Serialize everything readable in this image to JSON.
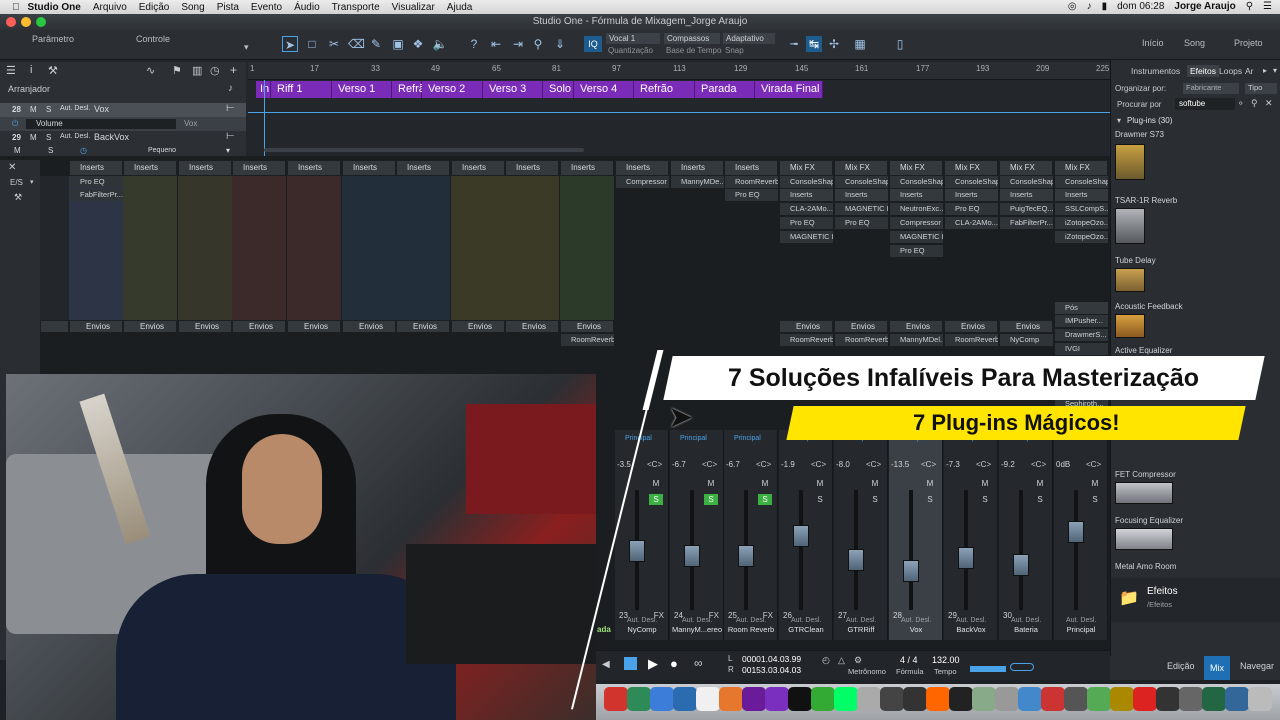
{
  "menubar": {
    "app": "Studio One",
    "items": [
      "Arquivo",
      "Edição",
      "Song",
      "Pista",
      "Evento",
      "Áudio",
      "Transporte",
      "Visualizar",
      "Ajuda"
    ],
    "clock": "dom 06:28",
    "user": "Jorge Araujo"
  },
  "window": {
    "title": "Studio One - Fórmula de Mixagem_Jorge Araujo"
  },
  "toolbar": {
    "parametro": "Parâmetro",
    "controle": "Controle",
    "quantizacao_value": "Vocal 1",
    "quantizacao_label": "Quantização",
    "base_value": "Compassos",
    "base_label": "Base de Tempo",
    "snap_value": "Adaptativo",
    "snap_label": "Snap",
    "iq": "IQ",
    "nav": [
      "Início",
      "Song",
      "Projeto"
    ]
  },
  "arranger": {
    "label": "Arranjador",
    "ticks": [
      "1",
      "17",
      "33",
      "49",
      "65",
      "81",
      "97",
      "113",
      "129",
      "145",
      "161",
      "177",
      "193",
      "209",
      "225"
    ],
    "sections": [
      "In",
      "Riff 1",
      "Verso 1",
      "Refrã",
      "Verso 2",
      "Verso 3",
      "Solo",
      "Verso 4",
      "Refrão",
      "Parada",
      "Virada Final"
    ]
  },
  "tracks": [
    {
      "num": "28",
      "m": "M",
      "s": "S",
      "auto": "Aut. Desl.",
      "name": "Vox"
    },
    {
      "param": "Volume",
      "target": "Vox"
    },
    {
      "num": "29",
      "m": "M",
      "s": "S",
      "auto": "Aut. Desl.",
      "name": "BackVox"
    },
    {
      "m": "M",
      "s": "S",
      "size": "Pequeno"
    }
  ],
  "mixer": {
    "es": "E/S",
    "inserts_label": "Inserts",
    "mixfx_label": "Mix FX",
    "envios_label": "Envios",
    "pos_label": "Pós",
    "inserts_col1": [
      "Pro EQ",
      "FabFilterPr..."
    ],
    "inserts_compressor": [
      "Compressor"
    ],
    "inserts_manny": [
      "MannyMDe..."
    ],
    "inserts_room": [
      "RoomReverb",
      "Pro EQ"
    ],
    "mixfx_cols": [
      {
        "a": "ConsoleShaper",
        "b": "Inserts",
        "c": "CLA-2AMo...",
        "d": "Pro EQ",
        "e": "MAGNETIC II"
      },
      {
        "a": "ConsoleShaper",
        "b": "Inserts",
        "c": "MAGNETIC II",
        "d": "Pro EQ",
        "e": ""
      },
      {
        "a": "ConsoleShaper",
        "b": "Inserts",
        "c": "NeutronExc...",
        "d": "Compressor",
        "e": "MAGNETIC II",
        "f": "Pro EQ"
      },
      {
        "a": "ConsoleShaper",
        "b": "Inserts",
        "c": "Pro EQ",
        "d": "CLA-2AMo...",
        "e": ""
      },
      {
        "a": "ConsoleShaper",
        "b": "Inserts",
        "c": "PuigTecEQ...",
        "d": "FabFilterPr...",
        "e": ""
      },
      {
        "a": "ConsoleShaper",
        "b": "Inserts",
        "c": "SSLCompS...",
        "d": "iZotopeOzo...",
        "e": "iZotopeOzo..."
      }
    ],
    "pos_plugins": [
      "IMPusher...",
      "DrawmerS...",
      "IVGI",
      "Sephiroth..."
    ],
    "sends": [
      "RoomReverb",
      "RoomReverb",
      "RoomReverb",
      "MannyMDel...",
      "RoomReverb",
      "NyComp"
    ],
    "channels": [
      {
        "num": "23",
        "val": "-3.5",
        "name": "NyComp",
        "auto": "Aut. Desl.",
        "bus": "Principal",
        "fader": 0.55
      },
      {
        "num": "24",
        "val": "-6.7",
        "name": "MannyM...ereo",
        "auto": "Aut. Desl.",
        "bus": "Principal",
        "fader": 0.5
      },
      {
        "num": "25",
        "val": "-6.7",
        "name": "Room Reverb",
        "auto": "Aut. Desl.",
        "bus": "Principal",
        "fader": 0.5
      },
      {
        "num": "26",
        "val": "-1.9",
        "name": "GTRClean",
        "auto": "Aut. Desl.",
        "bus": "Principal",
        "fader": 0.68
      },
      {
        "num": "27",
        "val": "-8.0",
        "name": "GTRRiff",
        "auto": "Aut. Desl.",
        "bus": "Principal",
        "fader": 0.46
      },
      {
        "num": "28",
        "val": "-13.5",
        "name": "Vox",
        "auto": "Aut. Desl.",
        "bus": "Principal",
        "fader": 0.36
      },
      {
        "num": "29",
        "val": "-7.3",
        "name": "BackVox",
        "auto": "Aut. Desl.",
        "bus": "Principal",
        "fader": 0.48
      },
      {
        "num": "30",
        "val": "-9.2",
        "name": "Bateria",
        "auto": "Aut. Desl.",
        "bus": "Principal",
        "fader": 0.42
      },
      {
        "num": "",
        "val": "0dB",
        "name": "Principal",
        "auto": "Aut. Desl.",
        "bus": "",
        "fader": 0.72
      }
    ],
    "fx_label": "FX",
    "first_name_fragment": "ada"
  },
  "browser": {
    "tabs": [
      "Instrumentos",
      "Efeitos",
      "Loops",
      "Ar"
    ],
    "organize": "Organizar por:",
    "organize_value": "Fabricante",
    "tipo": "Tipo",
    "search_label": "Procurar por",
    "search_value": "softube",
    "plugins_header": "Plug-ins (30)",
    "plugins": [
      "Drawmer S73",
      "TSAR-1R Reverb",
      "Tube Delay",
      "Acoustic Feedback",
      "Active Equalizer",
      "FET Compressor",
      "Focusing Equalizer",
      "Metal Amo Room"
    ],
    "folder_name": "Efeitos",
    "folder_path": "/Efeitos",
    "bottom": [
      "Edição",
      "Mix",
      "Navegar"
    ]
  },
  "transport": {
    "l": "L",
    "r": "R",
    "time_l": "00001.04.03.99",
    "time_r": "00153.03.04.03",
    "metronomo": "Metrônomo",
    "formula": "Fórmula",
    "formula_value": "4 / 4",
    "tempo": "Tempo",
    "tempo_value": "132.00"
  },
  "overlay": {
    "title": "7 Soluções Infalíveis Para Masterização",
    "subtitle": "7 Plug-ins Mágicos!"
  },
  "colors": {
    "section": "#7a2bb8",
    "solo": "#3cb043",
    "banner_yellow": "#ffe500",
    "accent_blue": "#4aa3e8"
  }
}
